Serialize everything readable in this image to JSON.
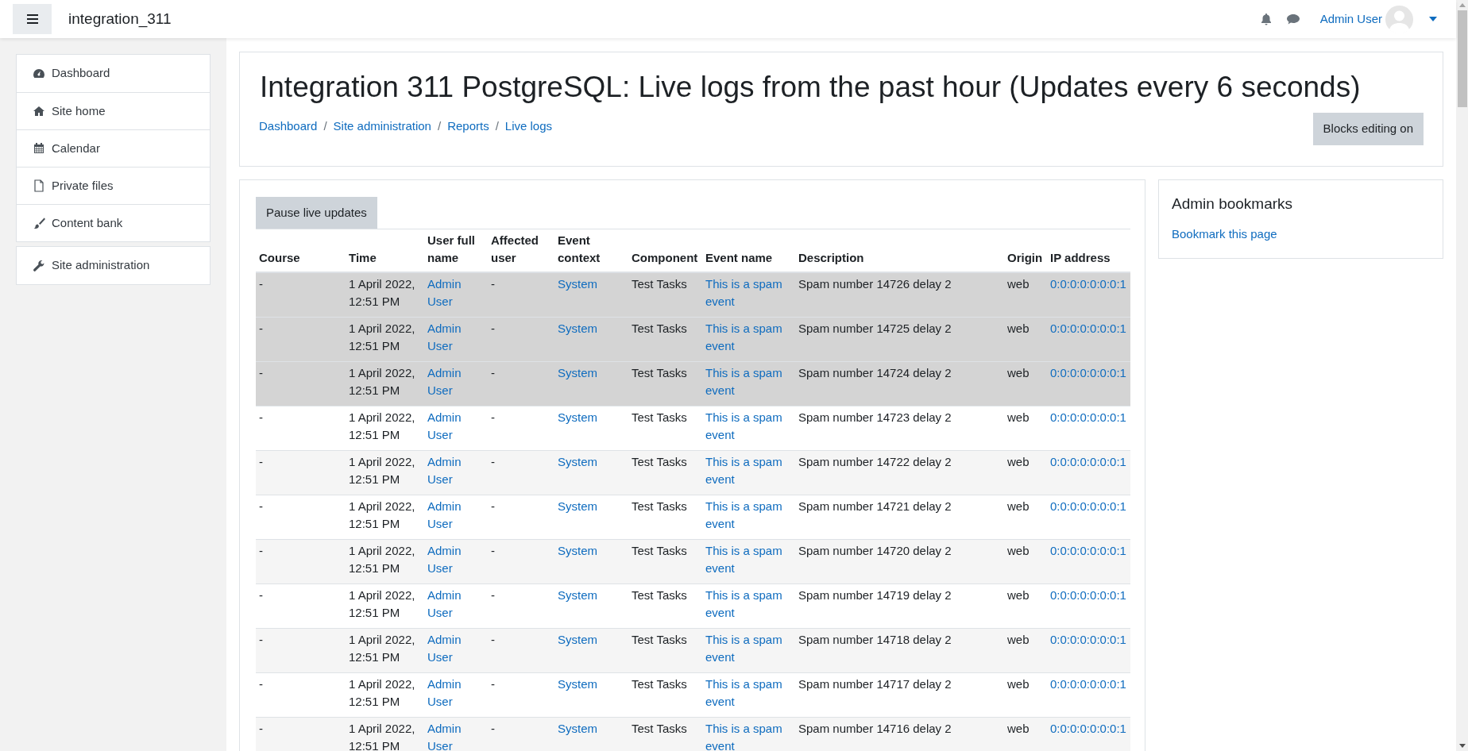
{
  "navbar": {
    "site_name": "integration_311",
    "user_name": "Admin User"
  },
  "sidebar": {
    "items": [
      {
        "label": "Dashboard"
      },
      {
        "label": "Site home"
      },
      {
        "label": "Calendar"
      },
      {
        "label": "Private files"
      },
      {
        "label": "Content bank"
      },
      {
        "label": "Site administration"
      }
    ]
  },
  "header": {
    "title": "Integration 311 PostgreSQL: Live logs from the past hour (Updates every 6 seconds)",
    "breadcrumbs": [
      {
        "label": "Dashboard"
      },
      {
        "separator": "/",
        "label": "Site administration"
      },
      {
        "separator": "/",
        "label": "Reports"
      },
      {
        "separator": "/",
        "label": "Live logs"
      }
    ],
    "button": "Blocks editing on"
  },
  "log": {
    "pause_button": "Pause live updates",
    "columns": [
      {
        "label": "Course",
        "kind": "text"
      },
      {
        "label": "Time",
        "kind": "text"
      },
      {
        "label": "User full name",
        "kind": "link"
      },
      {
        "label": "Affected user",
        "kind": "text"
      },
      {
        "label": "Event context",
        "kind": "link"
      },
      {
        "label": "Component",
        "kind": "text"
      },
      {
        "label": "Event name",
        "kind": "link"
      },
      {
        "label": "Description",
        "kind": "text"
      },
      {
        "label": "Origin",
        "kind": "text"
      },
      {
        "label": "IP address",
        "kind": "link"
      }
    ],
    "rows": [
      {
        "highlighted": true,
        "cells": [
          "-",
          "1 April 2022, 12:51 PM",
          "Admin User",
          "-",
          "System",
          "Test Tasks",
          "This is a spam event",
          "Spam number 14726 delay 2",
          "web",
          "0:0:0:0:0:0:0:1"
        ]
      },
      {
        "highlighted": true,
        "cells": [
          "-",
          "1 April 2022, 12:51 PM",
          "Admin User",
          "-",
          "System",
          "Test Tasks",
          "This is a spam event",
          "Spam number 14725 delay 2",
          "web",
          "0:0:0:0:0:0:0:1"
        ]
      },
      {
        "highlighted": true,
        "cells": [
          "-",
          "1 April 2022, 12:51 PM",
          "Admin User",
          "-",
          "System",
          "Test Tasks",
          "This is a spam event",
          "Spam number 14724 delay 2",
          "web",
          "0:0:0:0:0:0:0:1"
        ]
      },
      {
        "highlighted": false,
        "cells": [
          "-",
          "1 April 2022, 12:51 PM",
          "Admin User",
          "-",
          "System",
          "Test Tasks",
          "This is a spam event",
          "Spam number 14723 delay 2",
          "web",
          "0:0:0:0:0:0:0:1"
        ]
      },
      {
        "highlighted": false,
        "cells": [
          "-",
          "1 April 2022, 12:51 PM",
          "Admin User",
          "-",
          "System",
          "Test Tasks",
          "This is a spam event",
          "Spam number 14722 delay 2",
          "web",
          "0:0:0:0:0:0:0:1"
        ]
      },
      {
        "highlighted": false,
        "cells": [
          "-",
          "1 April 2022, 12:51 PM",
          "Admin User",
          "-",
          "System",
          "Test Tasks",
          "This is a spam event",
          "Spam number 14721 delay 2",
          "web",
          "0:0:0:0:0:0:0:1"
        ]
      },
      {
        "highlighted": false,
        "cells": [
          "-",
          "1 April 2022, 12:51 PM",
          "Admin User",
          "-",
          "System",
          "Test Tasks",
          "This is a spam event",
          "Spam number 14720 delay 2",
          "web",
          "0:0:0:0:0:0:0:1"
        ]
      },
      {
        "highlighted": false,
        "cells": [
          "-",
          "1 April 2022, 12:51 PM",
          "Admin User",
          "-",
          "System",
          "Test Tasks",
          "This is a spam event",
          "Spam number 14719 delay 2",
          "web",
          "0:0:0:0:0:0:0:1"
        ]
      },
      {
        "highlighted": false,
        "cells": [
          "-",
          "1 April 2022, 12:51 PM",
          "Admin User",
          "-",
          "System",
          "Test Tasks",
          "This is a spam event",
          "Spam number 14718 delay 2",
          "web",
          "0:0:0:0:0:0:0:1"
        ]
      },
      {
        "highlighted": false,
        "cells": [
          "-",
          "1 April 2022, 12:51 PM",
          "Admin User",
          "-",
          "System",
          "Test Tasks",
          "This is a spam event",
          "Spam number 14717 delay 2",
          "web",
          "0:0:0:0:0:0:0:1"
        ]
      },
      {
        "highlighted": false,
        "cells": [
          "-",
          "1 April 2022, 12:51 PM",
          "Admin User",
          "-",
          "System",
          "Test Tasks",
          "This is a spam event",
          "Spam number 14716 delay 2",
          "web",
          "0:0:0:0:0:0:0:1"
        ]
      }
    ]
  },
  "bookmarks": {
    "title": "Admin bookmarks",
    "link": "Bookmark this page"
  }
}
